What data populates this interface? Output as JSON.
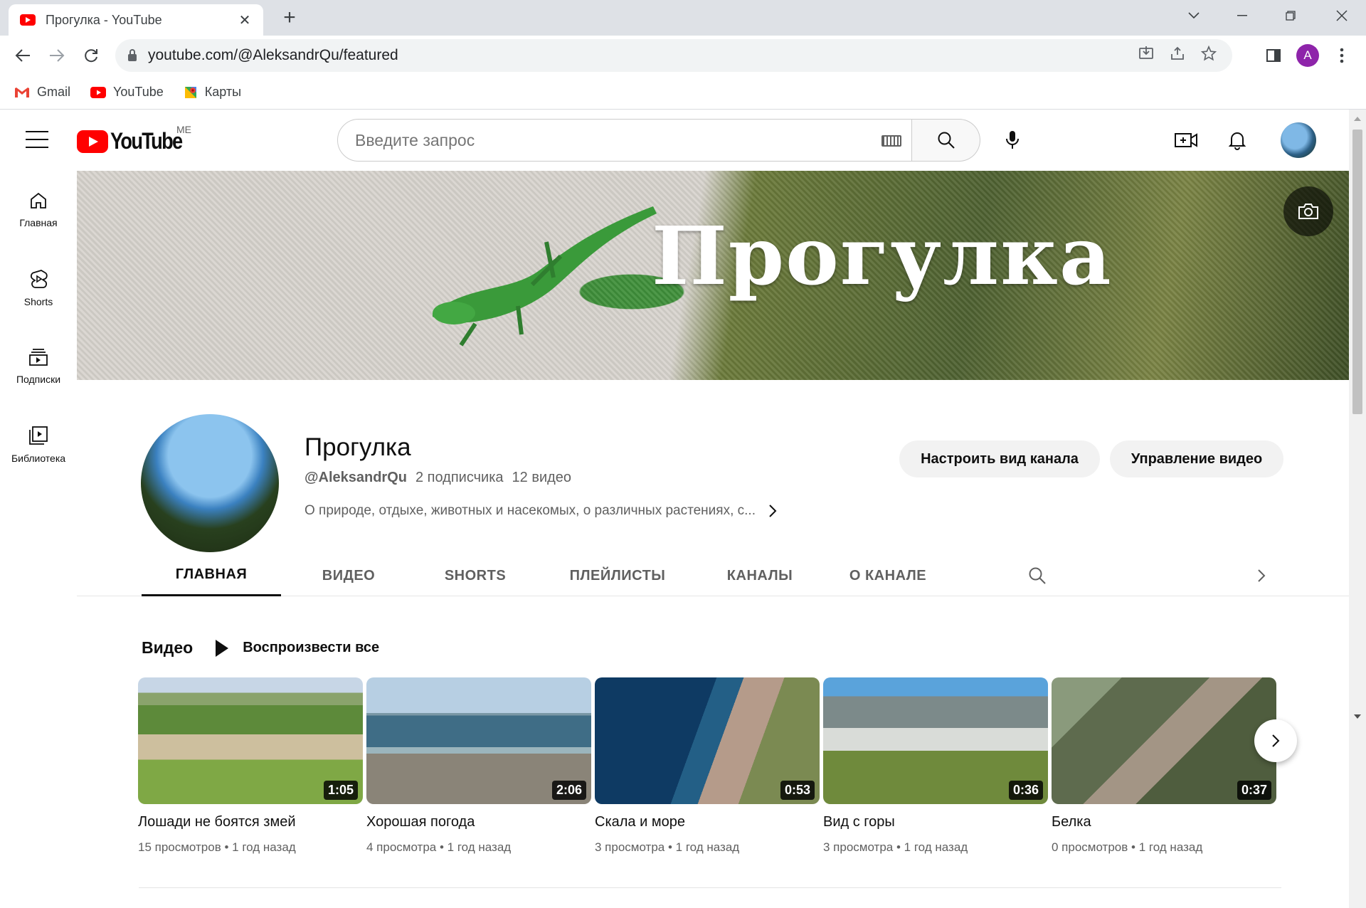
{
  "browser": {
    "tab_title": "Прогулка - YouTube",
    "url": "youtube.com/@AleksandrQu/featured",
    "profile_initial": "A",
    "bookmarks": [
      {
        "label": "Gmail",
        "icon": "gmail-icon"
      },
      {
        "label": "YouTube",
        "icon": "youtube-icon"
      },
      {
        "label": "Карты",
        "icon": "maps-icon"
      }
    ]
  },
  "masthead": {
    "logo_text": "YouTube",
    "country_code": "ME",
    "search_placeholder": "Введите запрос"
  },
  "guide": [
    {
      "label": "Главная",
      "icon": "home-icon"
    },
    {
      "label": "Shorts",
      "icon": "shorts-icon"
    },
    {
      "label": "Подписки",
      "icon": "subscriptions-icon"
    },
    {
      "label": "Библиотека",
      "icon": "library-icon"
    }
  ],
  "channel": {
    "banner_title": "Прогулка",
    "name": "Прогулка",
    "handle": "@AleksandrQu",
    "subscribers": "2 подписчика",
    "video_count": "12 видео",
    "description": "О природе, отдыхе, животных и насекомых, о различных растениях, с...",
    "customize_button": "Настроить вид канала",
    "manage_button": "Управление видео"
  },
  "tabs": [
    {
      "label": "ГЛАВНАЯ",
      "active": true
    },
    {
      "label": "ВИДЕО",
      "active": false
    },
    {
      "label": "SHORTS",
      "active": false
    },
    {
      "label": "ПЛЕЙЛИСТЫ",
      "active": false
    },
    {
      "label": "КАНАЛЫ",
      "active": false
    },
    {
      "label": "О КАНАЛЕ",
      "active": false
    }
  ],
  "shelf": {
    "title": "Видео",
    "play_all": "Воспроизвести все",
    "videos": [
      {
        "title": "Лошади не боятся змей",
        "duration": "1:05",
        "views": "15 просмотров",
        "age": "1 год назад"
      },
      {
        "title": "Хорошая погода",
        "duration": "2:06",
        "views": "4 просмотра",
        "age": "1 год назад"
      },
      {
        "title": "Скала и море",
        "duration": "0:53",
        "views": "3 просмотра",
        "age": "1 год назад"
      },
      {
        "title": "Вид с горы",
        "duration": "0:36",
        "views": "3 просмотра",
        "age": "1 год назад"
      },
      {
        "title": "Белка",
        "duration": "0:37",
        "views": "0 просмотров",
        "age": "1 год назад"
      }
    ]
  },
  "colors": {
    "youtube_red": "#ff0000",
    "profile_purple": "#8e24aa",
    "text_primary": "#0f0f0f",
    "text_secondary": "#606060"
  }
}
